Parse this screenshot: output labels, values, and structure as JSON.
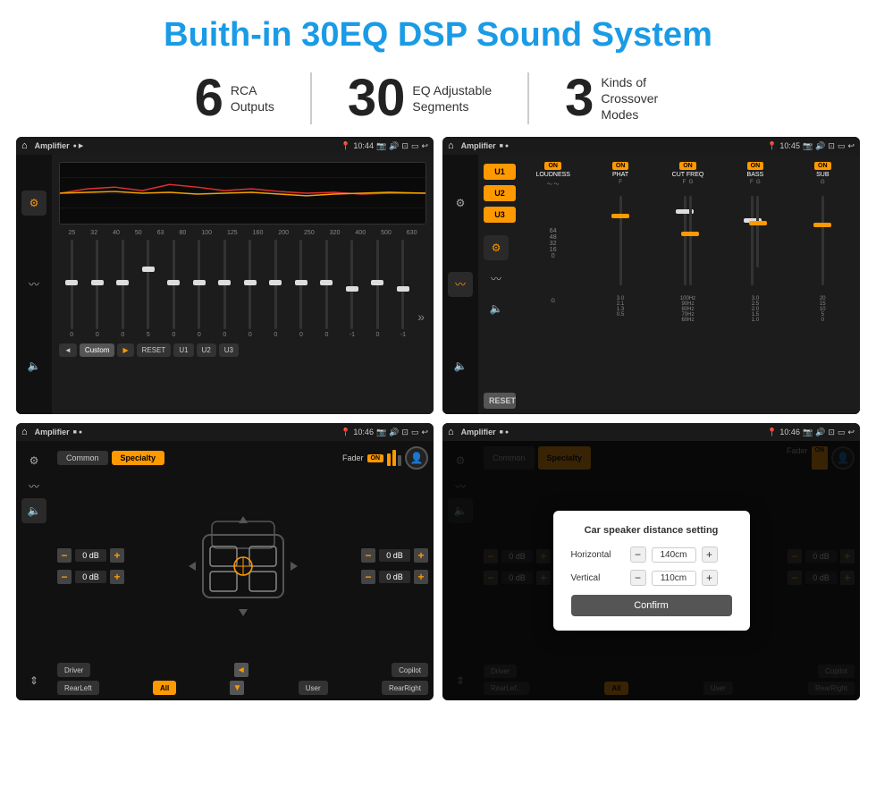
{
  "page": {
    "title": "Buith-in 30EQ DSP Sound System",
    "stats": [
      {
        "number": "6",
        "desc": "RCA\nOutputs"
      },
      {
        "number": "30",
        "desc": "EQ Adjustable\nSegments"
      },
      {
        "number": "3",
        "desc": "Kinds of\nCrossover Modes"
      }
    ],
    "screens": [
      {
        "id": "screen1",
        "statusBar": {
          "appTitle": "Amplifier",
          "time": "10:44"
        },
        "type": "eq"
      },
      {
        "id": "screen2",
        "statusBar": {
          "appTitle": "Amplifier",
          "time": "10:45"
        },
        "type": "crossover"
      },
      {
        "id": "screen3",
        "statusBar": {
          "appTitle": "Amplifier",
          "time": "10:46"
        },
        "type": "fader"
      },
      {
        "id": "screen4",
        "statusBar": {
          "appTitle": "Amplifier",
          "time": "10:46"
        },
        "type": "distance",
        "dialog": {
          "title": "Car speaker distance setting",
          "horizontal_label": "Horizontal",
          "horizontal_value": "140cm",
          "vertical_label": "Vertical",
          "vertical_value": "110cm",
          "confirm_label": "Confirm"
        }
      }
    ],
    "eqFreqs": [
      "25",
      "32",
      "40",
      "50",
      "63",
      "80",
      "100",
      "125",
      "160",
      "200",
      "250",
      "320",
      "400",
      "500",
      "630"
    ],
    "eqVals": [
      "0",
      "0",
      "0",
      "5",
      "0",
      "0",
      "0",
      "0",
      "0",
      "0",
      "0",
      "-1",
      "0",
      "-1"
    ],
    "eqButtons": [
      "Custom",
      "RESET",
      "U1",
      "U2",
      "U3"
    ],
    "crossoverCols": [
      "LOUDNESS",
      "PHAT",
      "CUT FREQ",
      "BASS",
      "SUB"
    ],
    "faderTabs": [
      "Common",
      "Specialty"
    ],
    "bottomLabels": [
      "Driver",
      "",
      "Copilot",
      "RearLeft",
      "All",
      "",
      "User",
      "RearRight"
    ],
    "dbValues": [
      "0 dB",
      "0 dB",
      "0 dB",
      "0 dB"
    ]
  }
}
